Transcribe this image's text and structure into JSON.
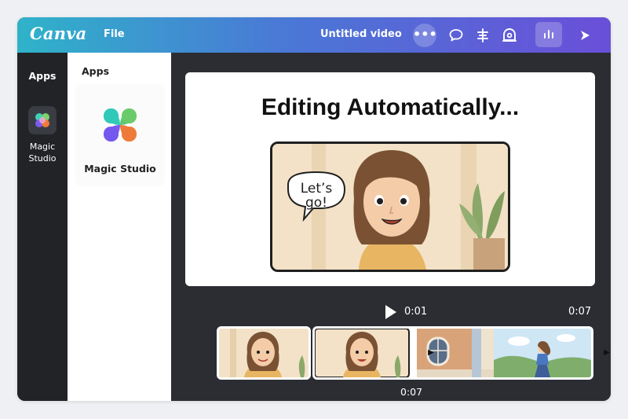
{
  "app": {
    "logo": "Canva",
    "file_menu": "File",
    "document_title": "Untitled video",
    "more_label": "•••"
  },
  "toolbar_icons": [
    "comment-icon",
    "align-icon",
    "timer-icon",
    "insights-icon",
    "play-present-icon"
  ],
  "rail": {
    "label": "Apps",
    "items": [
      {
        "label_line1": "Magic",
        "label_line2": "Studio",
        "icon": "magic-studio-icon"
      }
    ]
  },
  "panel": {
    "title": "Apps",
    "card": {
      "label": "Magic Studio",
      "icon": "magic-studio-logo"
    }
  },
  "slide": {
    "title": "Editing Automatically...",
    "speech_line1": "Let’s",
    "speech_line2": "go!"
  },
  "playback": {
    "current_time": "0:01",
    "total_time": "0:07",
    "timeline_time": "0:07"
  },
  "colors": {
    "gradient_start": "#2fb3c9",
    "gradient_mid": "#4a78d6",
    "gradient_end": "#6a4fd8",
    "editor_bg": "#2b2d33",
    "rail_bg": "#222327"
  }
}
